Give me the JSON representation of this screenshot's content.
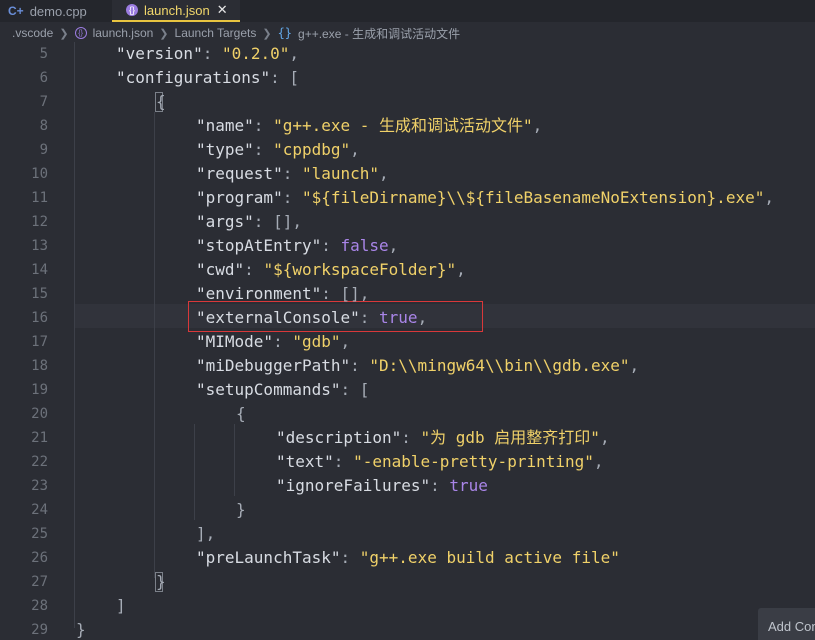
{
  "tabs": [
    {
      "label": "demo.cpp",
      "icon": "cpp-file-icon",
      "active": false
    },
    {
      "label": "launch.json",
      "icon": "json-file-icon",
      "active": true
    }
  ],
  "breadcrumb": [
    ".vscode",
    "launch.json",
    "Launch Targets",
    "g++.exe - 生成和调试活动文件"
  ],
  "editor": {
    "line_numbers": [
      "5",
      "6",
      "7",
      "8",
      "9",
      "10",
      "11",
      "12",
      "13",
      "14",
      "15",
      "16",
      "17",
      "18",
      "19",
      "20",
      "21",
      "22",
      "23",
      "24",
      "25",
      "26",
      "27",
      "28",
      "29"
    ],
    "lines": [
      [
        {
          "t": "\"version\"",
          "c": "k"
        },
        {
          "t": ": ",
          "c": "p"
        },
        {
          "t": "\"0.2.0\"",
          "c": "s"
        },
        {
          "t": ",",
          "c": "p"
        }
      ],
      [
        {
          "t": "\"configurations\"",
          "c": "k"
        },
        {
          "t": ": [",
          "c": "p"
        }
      ],
      [
        {
          "t": "{",
          "c": "p"
        }
      ],
      [
        {
          "t": "\"name\"",
          "c": "k"
        },
        {
          "t": ": ",
          "c": "p"
        },
        {
          "t": "\"g++.exe - 生成和调试活动文件\"",
          "c": "s"
        },
        {
          "t": ",",
          "c": "p"
        }
      ],
      [
        {
          "t": "\"type\"",
          "c": "k"
        },
        {
          "t": ": ",
          "c": "p"
        },
        {
          "t": "\"cppdbg\"",
          "c": "s"
        },
        {
          "t": ",",
          "c": "p"
        }
      ],
      [
        {
          "t": "\"request\"",
          "c": "k"
        },
        {
          "t": ": ",
          "c": "p"
        },
        {
          "t": "\"launch\"",
          "c": "s"
        },
        {
          "t": ",",
          "c": "p"
        }
      ],
      [
        {
          "t": "\"program\"",
          "c": "k"
        },
        {
          "t": ": ",
          "c": "p"
        },
        {
          "t": "\"${fileDirname}\\\\${fileBasenameNoExtension}.exe\"",
          "c": "s"
        },
        {
          "t": ",",
          "c": "p"
        }
      ],
      [
        {
          "t": "\"args\"",
          "c": "k"
        },
        {
          "t": ": [],",
          "c": "p"
        }
      ],
      [
        {
          "t": "\"stopAtEntry\"",
          "c": "k"
        },
        {
          "t": ": ",
          "c": "p"
        },
        {
          "t": "false",
          "c": "b"
        },
        {
          "t": ",",
          "c": "p"
        }
      ],
      [
        {
          "t": "\"cwd\"",
          "c": "k"
        },
        {
          "t": ": ",
          "c": "p"
        },
        {
          "t": "\"${workspaceFolder}\"",
          "c": "s"
        },
        {
          "t": ",",
          "c": "p"
        }
      ],
      [
        {
          "t": "\"environment\"",
          "c": "k"
        },
        {
          "t": ": [],",
          "c": "p"
        }
      ],
      [
        {
          "t": "\"externalConsole\"",
          "c": "k"
        },
        {
          "t": ": ",
          "c": "p"
        },
        {
          "t": "true",
          "c": "b"
        },
        {
          "t": ",",
          "c": "p"
        }
      ],
      [
        {
          "t": "\"MIMode\"",
          "c": "k"
        },
        {
          "t": ": ",
          "c": "p"
        },
        {
          "t": "\"gdb\"",
          "c": "s"
        },
        {
          "t": ",",
          "c": "p"
        }
      ],
      [
        {
          "t": "\"miDebuggerPath\"",
          "c": "k"
        },
        {
          "t": ": ",
          "c": "p"
        },
        {
          "t": "\"D:\\\\mingw64\\\\bin\\\\gdb.exe\"",
          "c": "s"
        },
        {
          "t": ",",
          "c": "p"
        }
      ],
      [
        {
          "t": "\"setupCommands\"",
          "c": "k"
        },
        {
          "t": ": [",
          "c": "p"
        }
      ],
      [
        {
          "t": "{",
          "c": "p"
        }
      ],
      [
        {
          "t": "\"description\"",
          "c": "k"
        },
        {
          "t": ": ",
          "c": "p"
        },
        {
          "t": "\"为 gdb 启用整齐打印\"",
          "c": "s"
        },
        {
          "t": ",",
          "c": "p"
        }
      ],
      [
        {
          "t": "\"text\"",
          "c": "k"
        },
        {
          "t": ": ",
          "c": "p"
        },
        {
          "t": "\"-enable-pretty-printing\"",
          "c": "s"
        },
        {
          "t": ",",
          "c": "p"
        }
      ],
      [
        {
          "t": "\"ignoreFailures\"",
          "c": "k"
        },
        {
          "t": ": ",
          "c": "p"
        },
        {
          "t": "true",
          "c": "b"
        }
      ],
      [
        {
          "t": "}",
          "c": "p"
        }
      ],
      [
        {
          "t": "],",
          "c": "p"
        }
      ],
      [
        {
          "t": "\"preLaunchTask\"",
          "c": "k"
        },
        {
          "t": ": ",
          "c": "p"
        },
        {
          "t": "\"g++.exe build active file\"",
          "c": "s"
        }
      ],
      [
        {
          "t": "}",
          "c": "p"
        }
      ],
      [
        {
          "t": "]",
          "c": "p"
        }
      ],
      [
        {
          "t": "}",
          "c": "p"
        }
      ]
    ],
    "highlighted_line": "16"
  },
  "add_configuration_label": "Add Configuration..."
}
